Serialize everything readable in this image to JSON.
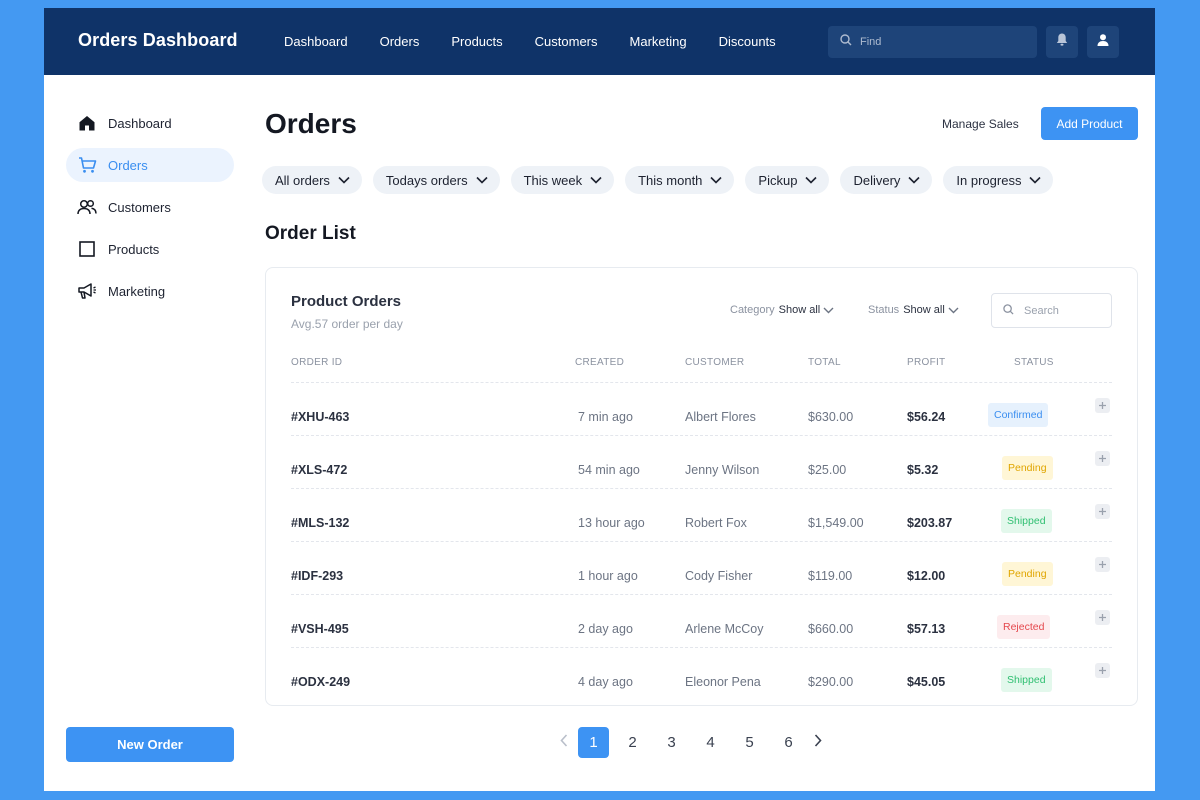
{
  "app": {
    "title": "Orders Dashboard"
  },
  "topnav": {
    "items": [
      {
        "label": "Dashboard"
      },
      {
        "label": "Orders"
      },
      {
        "label": "Products"
      },
      {
        "label": "Customers"
      },
      {
        "label": "Marketing"
      },
      {
        "label": "Discounts"
      }
    ],
    "find_placeholder": "Find"
  },
  "sidebar": {
    "items": [
      {
        "label": "Dashboard",
        "icon": "home-icon"
      },
      {
        "label": "Orders",
        "icon": "cart-icon",
        "active": true
      },
      {
        "label": "Customers",
        "icon": "users-icon"
      },
      {
        "label": "Products",
        "icon": "box-icon"
      },
      {
        "label": "Marketing",
        "icon": "megaphone-icon"
      }
    ],
    "new_order_label": "New Order"
  },
  "page": {
    "title": "Orders",
    "manage_sales_label": "Manage Sales",
    "add_product_label": "Add Product",
    "filters": [
      {
        "label": "All orders"
      },
      {
        "label": "Todays orders"
      },
      {
        "label": "This week"
      },
      {
        "label": "This month"
      },
      {
        "label": "Pickup"
      },
      {
        "label": "Delivery"
      },
      {
        "label": "In progress"
      }
    ],
    "section_title": "Order List"
  },
  "card": {
    "title": "Product Orders",
    "subtitle": "Avg.57 order per day",
    "category_label": "Category",
    "category_value": "Show all",
    "status_label": "Status",
    "status_value": "Show all",
    "search_placeholder": "Search",
    "columns": {
      "order_id": "ORDER ID",
      "created": "CREATED",
      "customer": "CUSTOMER",
      "total": "TOTAL",
      "profit": "PROFIT",
      "status": "STATUS"
    },
    "rows": [
      {
        "id": "#XHU-463",
        "created": "7 min ago",
        "customer": "Albert Flores",
        "total": "$630.00",
        "profit": "$56.24",
        "status": "Confirmed"
      },
      {
        "id": "#XLS-472",
        "created": "54 min ago",
        "customer": "Jenny Wilson",
        "total": "$25.00",
        "profit": "$5.32",
        "status": "Pending"
      },
      {
        "id": "#MLS-132",
        "created": "13 hour ago",
        "customer": "Robert Fox",
        "total": "$1,549.00",
        "profit": "$203.87",
        "status": "Shipped"
      },
      {
        "id": "#IDF-293",
        "created": "1 hour ago",
        "customer": "Cody Fisher",
        "total": "$119.00",
        "profit": "$12.00",
        "status": "Pending"
      },
      {
        "id": "#VSH-495",
        "created": "2 day ago",
        "customer": "Arlene McCoy",
        "total": "$660.00",
        "profit": "$57.13",
        "status": "Rejected"
      },
      {
        "id": "#ODX-249",
        "created": "4 day ago",
        "customer": "Eleonor Pena",
        "total": "$290.00",
        "profit": "$45.05",
        "status": "Shipped"
      }
    ]
  },
  "status_colors": {
    "Confirmed": {
      "bg": "#e6f1fd",
      "fg": "#3a8ef0"
    },
    "Pending": {
      "bg": "#fff6d6",
      "fg": "#e0a500"
    },
    "Shipped": {
      "bg": "#e3f8ec",
      "fg": "#2fbf71"
    },
    "Rejected": {
      "bg": "#fdecee",
      "fg": "#e5484d"
    }
  },
  "pagination": {
    "pages": [
      "1",
      "2",
      "3",
      "4",
      "5",
      "6"
    ],
    "current": "1"
  },
  "colors": {
    "topbar": "#0f3368",
    "accent": "#3d93f3",
    "background": "#4499f2"
  }
}
